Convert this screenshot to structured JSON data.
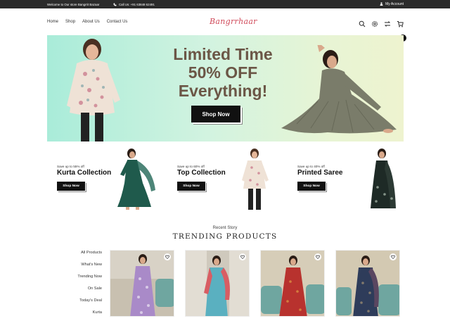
{
  "topbar": {
    "welcome": "Welcome to Our store Bangrrit Bazaar",
    "call": "Call Us: +91 63848 62491",
    "account": "My Account"
  },
  "nav": {
    "links": [
      "Home",
      "Shop",
      "About Us",
      "Contact Us"
    ],
    "logo": "Bangrrhaar",
    "cart_count": "0"
  },
  "hero": {
    "headline_1": "Limited Time",
    "headline_2": "50% OFF",
    "headline_3": "Everything!",
    "button": "Shop Now"
  },
  "promos": [
    {
      "save": "Save up to 55% off",
      "title": "Kurta Collection",
      "button": "Shop Now"
    },
    {
      "save": "Save up to 60% off",
      "title": "Top Collection",
      "button": "Shop Now"
    },
    {
      "save": "Save up to 40% off",
      "title": "Printed Saree",
      "button": "Shop Now"
    }
  ],
  "trending": {
    "subtitle": "Recent Story",
    "title": "TRENDING PRODUCTS",
    "categories": [
      "All Products",
      "What's New",
      "Trending Now",
      "On Sale",
      "Today's Deal",
      "Kurta"
    ]
  },
  "colors": {
    "topbar": "#2b2b2b",
    "accent_logo": "#d04a5a",
    "hero_text": "#6b5646"
  }
}
